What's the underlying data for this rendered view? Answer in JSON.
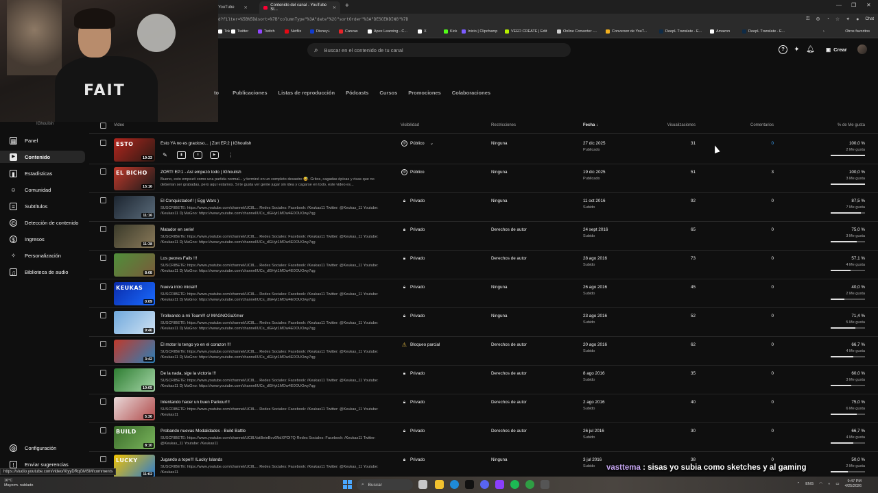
{
  "browser": {
    "tabs": [
      {
        "label": "YouTube"
      },
      {
        "label": "Contenido del canal - YouTube St..."
      }
    ],
    "url": "d?filter=%5B%5D&sort=%7B\"columnType\"%3A\"date\"%2C\"sortOrder\"%3A\"DESCENDING\"%7D",
    "chat_label": "Chat",
    "bookmarks": [
      {
        "label": "Tok",
        "color": "#ffffff"
      },
      {
        "label": "Twitter",
        "color": "#ffffff"
      },
      {
        "label": "Twitch",
        "color": "#9146ff"
      },
      {
        "label": "Netflix",
        "color": "#e50914"
      },
      {
        "label": "Disney+",
        "color": "#113ccf"
      },
      {
        "label": "Canvas",
        "color": "#e72429"
      },
      {
        "label": "Apex Learning - C...",
        "color": "#ffffff"
      },
      {
        "label": "X",
        "color": "#ffffff"
      },
      {
        "label": "Kick",
        "color": "#53fc18"
      },
      {
        "label": "Inicio | Clipchamp",
        "color": "#7c5cff"
      },
      {
        "label": "VEED CREATE | Edit",
        "color": "#b6f000"
      },
      {
        "label": "Online Converter -...",
        "color": "#cfcfcf"
      },
      {
        "label": "Conversor de YouT...",
        "color": "#f2b01e"
      },
      {
        "label": "DeepL Translate - E...",
        "color": "#0f2b46"
      },
      {
        "label": "Amazon",
        "color": "#ffffff"
      },
      {
        "label": "DeepL Translate - E...",
        "color": "#0f2b46"
      }
    ],
    "other_bookmarks": "Otros favoritos"
  },
  "header": {
    "search_placeholder": "Buscar en el contenido de tu canal",
    "create_label": "Crear"
  },
  "content_tabs": [
    "to",
    "Publicaciones",
    "Listas de reproducción",
    "Pódcasts",
    "Cursos",
    "Promociones",
    "Colaboraciones"
  ],
  "channel_name": "IGhoulish",
  "sidebar": {
    "items": [
      {
        "label": "Panel",
        "icon": "dashboard-icon"
      },
      {
        "label": "Contenido",
        "icon": "content-icon",
        "active": true
      },
      {
        "label": "Estadísticas",
        "icon": "analytics-icon"
      },
      {
        "label": "Comunidad",
        "icon": "community-icon"
      },
      {
        "label": "Subtítulos",
        "icon": "subtitles-icon"
      },
      {
        "label": "Detección de contenido",
        "icon": "copyright-icon"
      },
      {
        "label": "Ingresos",
        "icon": "earn-icon"
      },
      {
        "label": "Personalización",
        "icon": "customization-icon"
      },
      {
        "label": "Biblioteca de audio",
        "icon": "audio-library-icon"
      }
    ],
    "settings_label": "Configuración",
    "feedback_label": "Enviar sugerencias"
  },
  "table": {
    "columns": {
      "video": "Video",
      "visibility": "Visibilidad",
      "restrictions": "Restricciones",
      "date": "Fecha",
      "views": "Visualizaciones",
      "comments": "Comentarios",
      "likes": "% de Me gusta"
    },
    "rows": [
      {
        "title": "Esto YA no es gracioso... | Zort EP.2 | IGhoulish",
        "description": "",
        "duration": "19:33",
        "visibility": "Público",
        "vis_icon": "globe-icon",
        "restrictions": "Ninguna",
        "date": "27 dic 2025",
        "date_status": "Publicado",
        "views": "31",
        "comments": "0",
        "likes_pct": "100,0 %",
        "likes_count": "2 Me gusta",
        "likes_fraction": 1.0,
        "thumb_text": "ESTO",
        "thumb_colors": [
          "#b3261e",
          "#2d1a14"
        ]
      },
      {
        "title": "ZORT! EP.1 - Así empezó todo | IGhoulish",
        "description": "Bueno, esto empezó como una partida normal... y terminó en un completo desastre 😅. Gritos, cagadas épicas y risas que no deberían ser grabadas, pero aquí estamos. Si te gusta ver gente jugar sin idea y cagarse en todo, este video es...",
        "duration": "15:16",
        "visibility": "Público",
        "vis_icon": "globe-icon",
        "restrictions": "Ninguna",
        "date": "19 dic 2025",
        "date_status": "Publicado",
        "views": "51",
        "comments": "3",
        "likes_pct": "100,0 %",
        "likes_count": "3 Me gusta",
        "likes_fraction": 1.0,
        "thumb_text": "EL BICHO",
        "thumb_colors": [
          "#c0392b",
          "#1a1a1a"
        ]
      },
      {
        "title": "El Conquistador!! ( Egg Wars )",
        "description": "SUSCRIBETE: https://www.youtube.com/channel/UC8L... Redes Sociales: Facebook: /Keukas11 Twitter: @Keukas_11 Youtube: /Keukas11 Dj MaGno: https://www.youtube.com/channel/UCs_dGHyt1MOw4E0OUOwy7qg",
        "duration": "11:16",
        "visibility": "Privado",
        "vis_icon": "lock-icon",
        "restrictions": "Ninguna",
        "date": "11 oct 2016",
        "date_status": "Subido",
        "views": "92",
        "comments": "0",
        "likes_pct": "87,5 %",
        "likes_count": "7 Me gusta",
        "likes_fraction": 0.875,
        "thumb_text": "",
        "thumb_colors": [
          "#1c2530",
          "#5a6b7a"
        ]
      },
      {
        "title": "Matador en serie!",
        "description": "SUSCRIBETE: https://www.youtube.com/channel/UC8L... Redes Sociales: Facebook: /Keukas11 Twitter: @Keukas_11 Youtube: /Keukas11 Dj MaGno: https://www.youtube.com/channel/UCs_dGHyt1MOw4E0OUOwy7qg",
        "duration": "11:38",
        "visibility": "Privado",
        "vis_icon": "lock-icon",
        "restrictions": "Derechos de autor",
        "date": "24 sept 2016",
        "date_status": "Subido",
        "views": "65",
        "comments": "0",
        "likes_pct": "75,0 %",
        "likes_count": "3 Me gusta",
        "likes_fraction": 0.75,
        "thumb_text": "",
        "thumb_colors": [
          "#3a3a2a",
          "#8a7a5a"
        ]
      },
      {
        "title": "Los peores Fails !!!",
        "description": "SUSCRIBETE: https://www.youtube.com/channel/UC8L... Redes Sociales: Facebook: /Keukas11 Twitter: @Keukas_11 Youtube: /Keukas11 Dj MaGno: https://www.youtube.com/channel/UCs_dGHyt1MOw4E0OUOwy7qg",
        "duration": "8:08",
        "visibility": "Privado",
        "vis_icon": "lock-icon",
        "restrictions": "Derechos de autor",
        "date": "28 ago 2016",
        "date_status": "Subido",
        "views": "73",
        "comments": "0",
        "likes_pct": "57,1 %",
        "likes_count": "4 Me gusta",
        "likes_fraction": 0.571,
        "thumb_text": "",
        "thumb_colors": [
          "#4f8f3a",
          "#7a5a3a"
        ]
      },
      {
        "title": "Nueva intro inicial!!",
        "description": "SUSCRIBETE: https://www.youtube.com/channel/UC8L... Redes Sociales: Facebook: /Keukas11 Twitter: @Keukas_11 Youtube: /Keukas11 Dj MaGno: https://www.youtube.com/channel/UCs_dGHyt1MOw4E0OUOwy7qg",
        "duration": "0:09",
        "visibility": "Privado",
        "vis_icon": "lock-icon",
        "restrictions": "Ninguna",
        "date": "26 ago 2016",
        "date_status": "Subido",
        "views": "45",
        "comments": "0",
        "likes_pct": "40,0 %",
        "likes_count": "2 Me gusta",
        "likes_fraction": 0.4,
        "thumb_text": "KEUKAS",
        "thumb_colors": [
          "#0a2aa8",
          "#1a6bff"
        ]
      },
      {
        "title": "Trolleando a mi Team!!! c/ MAGNOGaXmer",
        "description": "SUSCRIBETE: https://www.youtube.com/channel/UC8L... Redes Sociales: Facebook: /Keukas11 Twitter: @Keukas_11 Youtube: /Keukas11 Dj MaGno: https://www.youtube.com/channel/UCs_dGHyt1MOw4E0OUOwy7qg",
        "duration": "9:46",
        "visibility": "Privado",
        "vis_icon": "lock-icon",
        "restrictions": "Ninguna",
        "date": "23 ago 2016",
        "date_status": "Subido",
        "views": "52",
        "comments": "0",
        "likes_pct": "71,4 %",
        "likes_count": "5 Me gusta",
        "likes_fraction": 0.714,
        "thumb_text": "",
        "thumb_colors": [
          "#6fa8dc",
          "#cfe2f3"
        ]
      },
      {
        "title": "El motor lo tengo yo en el corazon !!!",
        "description": "SUSCRIBETE: https://www.youtube.com/channel/UC8L... Redes Sociales: Facebook: /Keukas11 Twitter: @Keukas_11 Youtube: /Keukas11 Dj MaGno: https://www.youtube.com/channel/UCs_dGHyt1MOw4E0OUOwy7qg",
        "duration": "3:42",
        "visibility": "Bloqueo parcial",
        "vis_icon": "warning-icon",
        "restrictions": "Derechos de autor",
        "date": "20 ago 2016",
        "date_status": "Subido",
        "views": "62",
        "comments": "0",
        "likes_pct": "66,7 %",
        "likes_count": "4 Me gusta",
        "likes_fraction": 0.667,
        "thumb_text": "",
        "thumb_colors": [
          "#c0392b",
          "#2c7fb8"
        ]
      },
      {
        "title": "De la nada, sige la victoria !!!",
        "description": "SUSCRIBETE: https://www.youtube.com/channel/UC8L... Redes Sociales: Facebook: /Keukas11 Twitter: @Keukas_11 Youtube: /Keukas11 Dj MaGno: https://www.youtube.com/channel/UCs_dGHyt1MOw4E0OUOwy7qg",
        "duration": "10:05",
        "visibility": "Privado",
        "vis_icon": "lock-icon",
        "restrictions": "Derechos de autor",
        "date": "8 ago 2016",
        "date_status": "Subido",
        "views": "35",
        "comments": "0",
        "likes_pct": "60,0 %",
        "likes_count": "3 Me gusta",
        "likes_fraction": 0.6,
        "thumb_text": "",
        "thumb_colors": [
          "#2e7d32",
          "#a5d6a7"
        ]
      },
      {
        "title": "Intentando hacer un buen Parkour!!!",
        "description": "SUSCRIBETE: https://www.youtube.com/channel/UC8L... Redes Sociales: Facebook: /Keukas11 Twitter: @Keukas_11 Youtube: /Keukas11",
        "duration": "5:36",
        "visibility": "Privado",
        "vis_icon": "lock-icon",
        "restrictions": "Derechos de autor",
        "date": "2 ago 2016",
        "date_status": "Subido",
        "views": "40",
        "comments": "0",
        "likes_pct": "75,0 %",
        "likes_count": "6 Me gusta",
        "likes_fraction": 0.75,
        "thumb_text": "",
        "thumb_colors": [
          "#e8d8d8",
          "#b04a4a"
        ]
      },
      {
        "title": "Probando nuevas Modalidades - Build Battle",
        "description": "SUSCRIBETE: https://www.youtube.com/channel/UC8LVatBeieBcv6NdXPDI7Q Redes Sociales: Facebook: /Keukas11 Twitter: @Keukas_11 Youtube: /Keukas11",
        "duration": "8:10",
        "visibility": "Privado",
        "vis_icon": "lock-icon",
        "restrictions": "Derechos de autor",
        "date": "26 jul 2016",
        "date_status": "Subido",
        "views": "30",
        "comments": "0",
        "likes_pct": "66,7 %",
        "likes_count": "4 Me gusta",
        "likes_fraction": 0.667,
        "thumb_text": "BUILD",
        "thumb_colors": [
          "#3a6b2a",
          "#7ab55c"
        ]
      },
      {
        "title": "Jugando a tope!!! /Lucky Islands",
        "description": "SUSCRIBETE: https://www.youtube.com/channel/UC8L... Redes Sociales: Facebook: /Keukas11 Twitter: @Keukas_11 Youtube: /Keukas11",
        "duration": "11:02",
        "visibility": "Privado",
        "vis_icon": "lock-icon",
        "restrictions": "Ninguna",
        "date": "3 jul 2016",
        "date_status": "Subido",
        "views": "38",
        "comments": "0",
        "likes_pct": "50,0 %",
        "likes_count": "2 Me gusta",
        "likes_fraction": 0.5,
        "thumb_text": "LUCKY",
        "thumb_colors": [
          "#f2c200",
          "#2a7ad1"
        ]
      }
    ]
  },
  "status_url": "https://studio.youtube.com/video/XtyyDRqGMSM/comments",
  "chat_overlay": {
    "user": "vasttema",
    "message": " : sisas yo subia como sketches y al gaming"
  },
  "taskbar": {
    "weather_temp": "16°C",
    "weather_desc": "Mayorm. nublado",
    "search_label": "Buscar",
    "lang": "ENG",
    "time": "9:47 PM",
    "date": "4/25/2026"
  }
}
